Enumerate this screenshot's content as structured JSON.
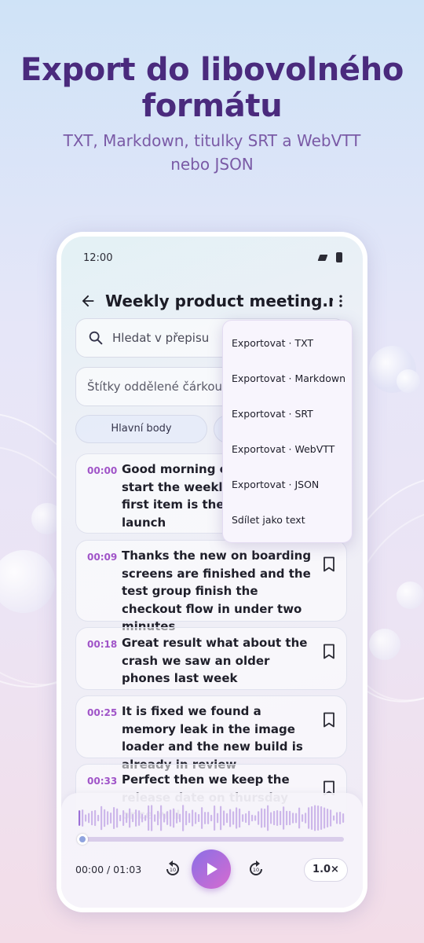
{
  "hero": {
    "title": "Export do libovolného formátu",
    "subtitle": "TXT, Markdown, titulky SRT a WebVTT nebo JSON"
  },
  "status_bar": {
    "time": "12:00"
  },
  "app_bar": {
    "title": "Weekly product meeting.m..."
  },
  "search": {
    "placeholder": "Hledat v přepisu"
  },
  "tags": {
    "placeholder": "Štítky oddělené čárkou"
  },
  "chips": {
    "main": "Hlavní body"
  },
  "segments": [
    {
      "time": "00:00",
      "text": "Good morning ev... start the weekly ... first item is the m... launch",
      "lines": [
        "Good morning ev",
        "start the weekly",
        "first item is the m",
        "launch"
      ]
    },
    {
      "time": "00:09",
      "text": "Thanks the new on boarding screens are finished and the test group finish the checkout flow in under two minutes"
    },
    {
      "time": "00:18",
      "text": "Great result what about the crash we saw an older phones last week"
    },
    {
      "time": "00:25",
      "text": "It is fixed we found a memory leak in the image loader and the new build is already in review"
    },
    {
      "time": "00:33",
      "text": "Perfect then we keep the release date on thursday once will"
    }
  ],
  "menu": {
    "items": [
      "Exportovat · TXT",
      "Exportovat · Markdown",
      "Exportovat · SRT",
      "Exportovat · WebVTT",
      "Exportovat · JSON",
      "Sdílet jako text"
    ]
  },
  "player": {
    "time": "00:00 / 01:03",
    "progress": 0.0,
    "speed": "1.0×",
    "rewind_seconds": "10",
    "forward_seconds": "10"
  },
  "colors": {
    "accent": "#a054c8",
    "title": "#4a2a7d",
    "subtitle": "#7a5aa6",
    "play_gradient_start": "#8a6fe6",
    "play_gradient_end": "#d66bd0"
  },
  "icons": {
    "back": "arrow-left-icon",
    "more": "more-vertical-icon",
    "search": "search-icon",
    "bookmark": "bookmark-icon",
    "rewind": "replay-10-icon",
    "forward": "forward-10-icon",
    "play": "play-icon"
  }
}
